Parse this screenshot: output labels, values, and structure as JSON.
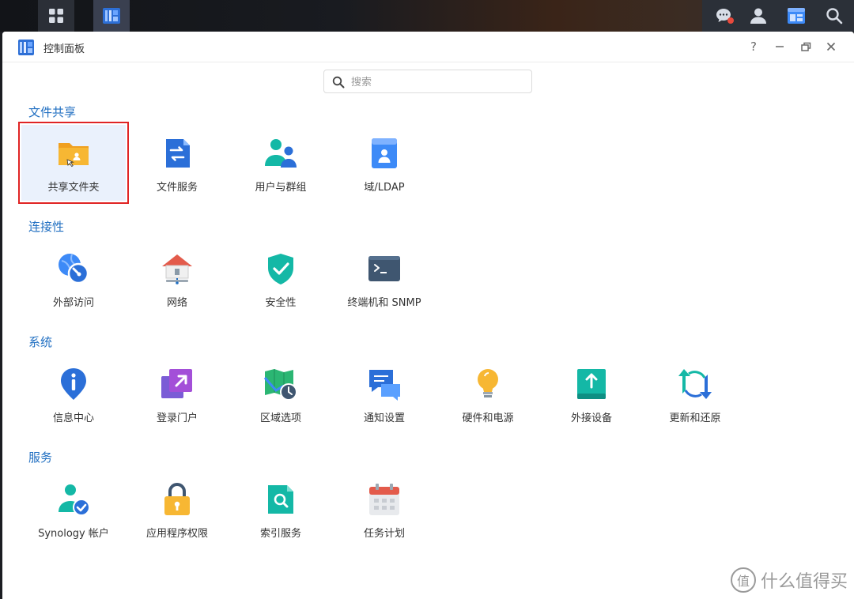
{
  "window": {
    "title": "控制面板"
  },
  "search": {
    "placeholder": "搜索",
    "value": ""
  },
  "sections": [
    {
      "title": "文件共享",
      "items": [
        {
          "label": "共享文件夹",
          "icon": "shared-folder-icon",
          "selected": true
        },
        {
          "label": "文件服务",
          "icon": "file-services-icon"
        },
        {
          "label": "用户与群组",
          "icon": "user-group-icon"
        },
        {
          "label": "域/LDAP",
          "icon": "domain-ldap-icon"
        }
      ]
    },
    {
      "title": "连接性",
      "items": [
        {
          "label": "外部访问",
          "icon": "external-access-icon"
        },
        {
          "label": "网络",
          "icon": "network-icon"
        },
        {
          "label": "安全性",
          "icon": "security-icon"
        },
        {
          "label": "终端机和 SNMP",
          "icon": "terminal-icon"
        }
      ]
    },
    {
      "title": "系统",
      "items": [
        {
          "label": "信息中心",
          "icon": "info-center-icon"
        },
        {
          "label": "登录门户",
          "icon": "login-portal-icon"
        },
        {
          "label": "区域选项",
          "icon": "regional-options-icon"
        },
        {
          "label": "通知设置",
          "icon": "notification-icon"
        },
        {
          "label": "硬件和电源",
          "icon": "hardware-power-icon"
        },
        {
          "label": "外接设备",
          "icon": "external-devices-icon"
        },
        {
          "label": "更新和还原",
          "icon": "update-restore-icon"
        }
      ]
    },
    {
      "title": "服务",
      "items": [
        {
          "label": "Synology 帐户",
          "icon": "synology-account-icon"
        },
        {
          "label": "应用程序权限",
          "icon": "app-privileges-icon"
        },
        {
          "label": "索引服务",
          "icon": "indexing-service-icon"
        },
        {
          "label": "任务计划",
          "icon": "task-scheduler-icon"
        }
      ]
    }
  ],
  "watermark": {
    "text": "什么值得买",
    "glyph": "值"
  },
  "colors": {
    "accent": "#1f6ec1",
    "selection_border": "#e02424",
    "selection_bg": "#eaf1fc"
  }
}
